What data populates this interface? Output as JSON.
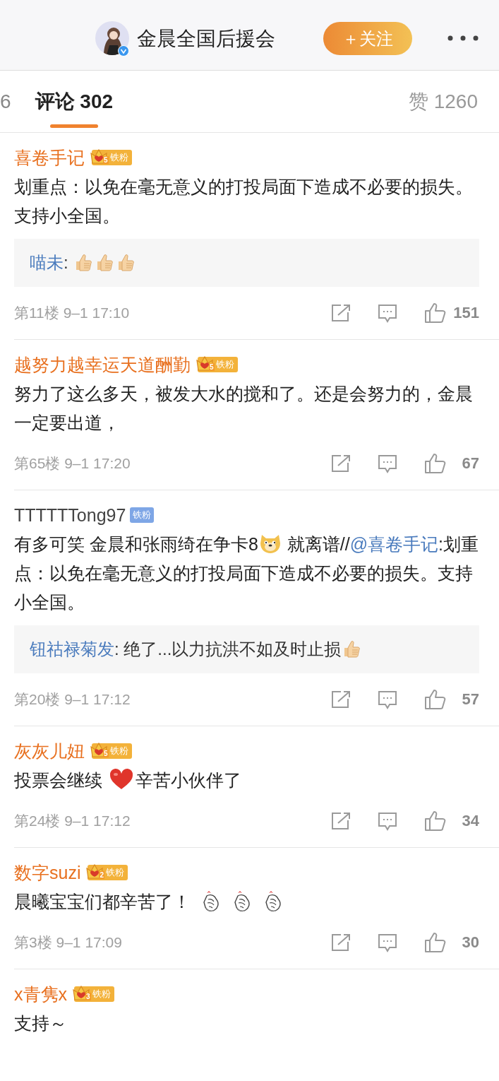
{
  "header": {
    "title": "金晨全国后援会",
    "follow_button": "＋关注"
  },
  "tabs": [
    {
      "label": "6",
      "selected": false
    },
    {
      "label": "评论 302",
      "selected": true
    }
  ],
  "likes_tab": "赞 1260",
  "comments": [
    {
      "author": "喜卷手记",
      "color": "#e8701f",
      "badge": {
        "kind": "crown",
        "level": "5",
        "label": "铁粉"
      },
      "content": [
        {
          "kind": "text",
          "text": "划重点：以免在毫无意义的打投局面下造成不必要的损失。支持小全国。"
        }
      ],
      "reply": {
        "author": "喵未",
        "content": [
          {
            "kind": "text",
            "text": ": "
          },
          {
            "kind": "thumb"
          },
          {
            "kind": "thumb"
          },
          {
            "kind": "thumb"
          }
        ]
      },
      "meta": "第11楼 9–1 17:10",
      "likes": "151"
    },
    {
      "author": "越努力越幸运天道酬勤",
      "color": "#e8701f",
      "badge": {
        "kind": "crown",
        "level": "5",
        "label": "铁粉"
      },
      "content": [
        {
          "kind": "text",
          "text": "努力了这么多天，被发大水的搅和了。还是会努力的，金晨一定要出道，"
        }
      ],
      "meta": "第65楼 9–1 17:20",
      "likes": "67"
    },
    {
      "author": "TTTTTTong97",
      "color": "#444444",
      "badge": {
        "kind": "plain",
        "label": "铁粉"
      },
      "content": [
        {
          "kind": "text",
          "text": "有多可笑 金晨和张雨绮在争卡8"
        },
        {
          "kind": "doge"
        },
        {
          "kind": "text",
          "text": " 就离谱//"
        },
        {
          "kind": "link",
          "text": "@喜卷手记"
        },
        {
          "kind": "text",
          "text": ":划重点：以免在毫无意义的打投局面下造成不必要的损失。支持小全国。"
        }
      ],
      "reply": {
        "author": "钮祜禄菊发",
        "content": [
          {
            "kind": "text",
            "text": ": 绝了...以力抗洪不如及时止损"
          },
          {
            "kind": "thumb"
          }
        ]
      },
      "meta": "第20楼 9–1 17:12",
      "likes": "57"
    },
    {
      "author": "灰灰儿妞",
      "color": "#e8701f",
      "badge": {
        "kind": "crown",
        "level": "5",
        "label": "铁粉"
      },
      "content": [
        {
          "kind": "text",
          "text": "投票会继续 "
        },
        {
          "kind": "heart"
        },
        {
          "kind": "text",
          "text": "辛苦小伙伴了"
        }
      ],
      "meta": "第24楼 9–1 17:12",
      "likes": "34"
    },
    {
      "author": "数字suzi",
      "color": "#e8701f",
      "badge": {
        "kind": "crown",
        "level": "2",
        "label": "铁粉"
      },
      "content": [
        {
          "kind": "text",
          "text": "晨曦宝宝们都辛苦了！ "
        },
        {
          "kind": "finger-heart"
        },
        {
          "kind": "finger-heart"
        },
        {
          "kind": "finger-heart"
        }
      ],
      "meta": "第3楼 9–1 17:09",
      "likes": "30"
    },
    {
      "author": "x青隽x",
      "color": "#e8701f",
      "badge": {
        "kind": "crown",
        "level": "3",
        "label": "铁粉"
      },
      "content": [
        {
          "kind": "text",
          "text": "支持～"
        }
      ]
    }
  ]
}
